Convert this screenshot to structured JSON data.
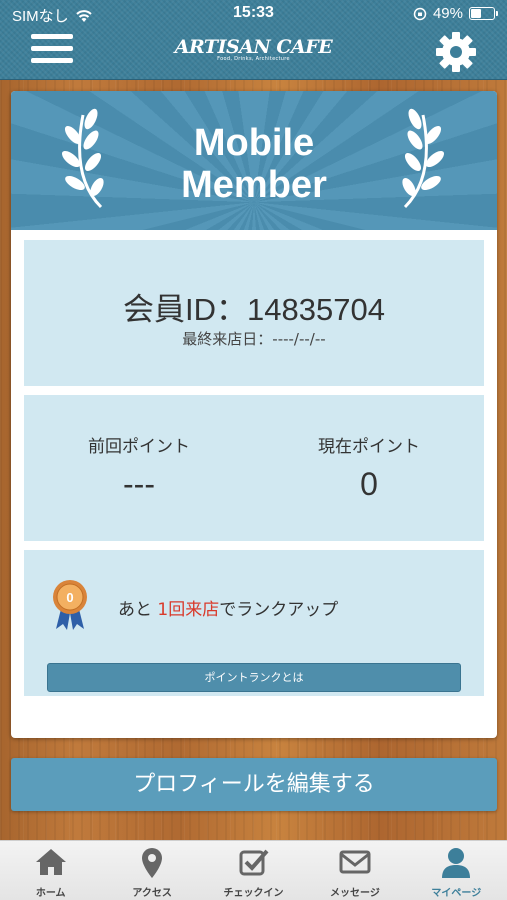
{
  "status_bar": {
    "carrier": "SIMなし",
    "time": "15:33",
    "battery": "49%",
    "battery_level": 0.49
  },
  "header": {
    "logo": "ARTISAN CAFE",
    "logo_sub": "Food, Drinks, Architecture",
    "menu_icon": "hamburger-icon",
    "settings_icon": "gear-icon"
  },
  "banner": {
    "title_line1": "Mobile",
    "title_line2": "Member"
  },
  "member": {
    "id_text": "会員ID：14835704",
    "last_visit": "最終来店日：----/--/--"
  },
  "points": {
    "previous_label": "前回ポイント",
    "previous_value": "---",
    "current_label": "現在ポイント",
    "current_value": "0"
  },
  "rank": {
    "prefix": "あと ",
    "highlight": "1回来店",
    "suffix": "でランクアップ",
    "button": "ポイントランクとは",
    "medal_number": "0",
    "highlight_color": "#d93a2b"
  },
  "profile_button": "プロフィールを編集する",
  "tabs": [
    {
      "label": "ホーム",
      "icon": "home-icon"
    },
    {
      "label": "アクセス",
      "icon": "location-pin-icon"
    },
    {
      "label": "チェックイン",
      "icon": "checkin-icon"
    },
    {
      "label": "メッセージ",
      "icon": "envelope-icon"
    },
    {
      "label": "マイページ",
      "icon": "user-icon",
      "active": true
    }
  ],
  "colors": {
    "header": "#3d7f9a",
    "panel": "#d1e8f1",
    "accent": "#5b9dbb"
  }
}
